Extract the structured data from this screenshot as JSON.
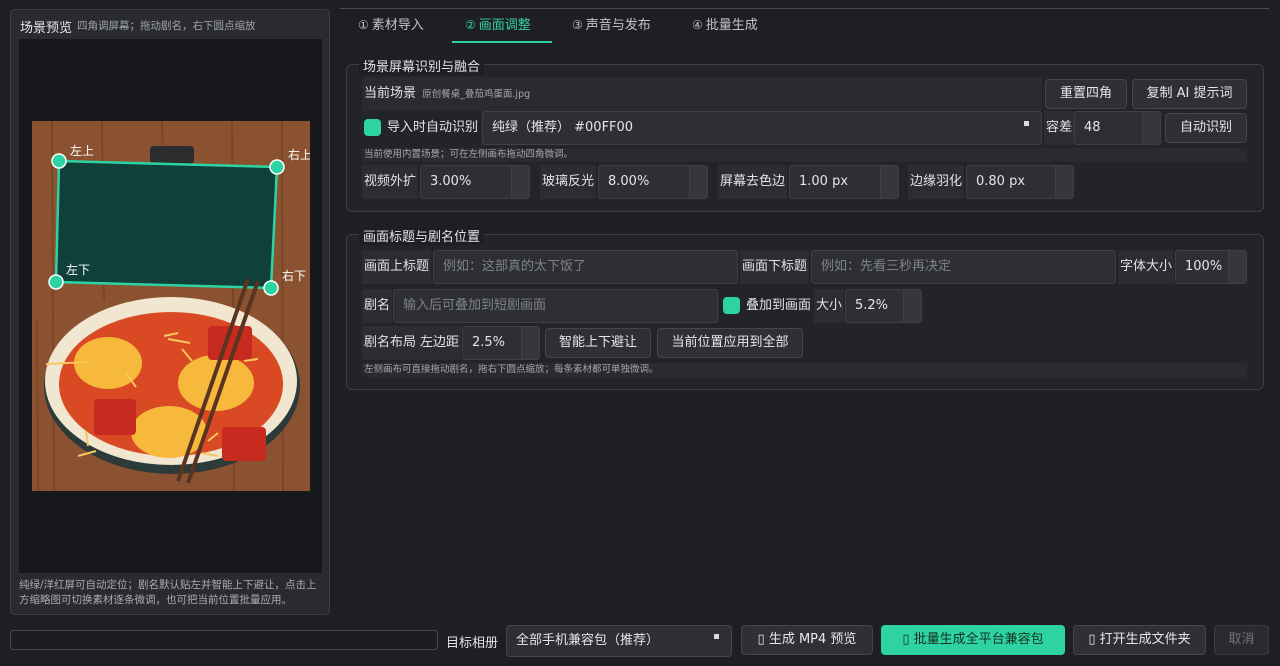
{
  "preview": {
    "title": "场景预览",
    "hint": "四角调屏幕；拖动剧名，右下圆点缩放",
    "corners": {
      "tl": "左上",
      "tr": "右上",
      "bl": "左下",
      "br": "右下"
    },
    "footer": "纯绿/洋红屏可自动定位；剧名默认贴左并智能上下避让，点击上方缩略图可切换素材逐条微调，也可把当前位置批量应用。"
  },
  "tabs": [
    {
      "num": "①",
      "label": "素材导入"
    },
    {
      "num": "②",
      "label": "画面调整"
    },
    {
      "num": "③",
      "label": "声音与发布"
    },
    {
      "num": "④",
      "label": "批量生成"
    }
  ],
  "screen_group": {
    "title": "场景屏幕识别与融合",
    "current_scene_label": "当前场景",
    "current_scene_value": "原创餐桌_叠茄鸡蛋面.jpg",
    "reset_corners": "重置四角",
    "copy_ai_prompt": "复制 AI 提示词",
    "auto_detect_on_import": "导入时自动识别",
    "color_mode": "纯绿（推荐）  #00FF00",
    "tolerance_label": "容差",
    "tolerance_value": "48",
    "auto_detect": "自动识别",
    "note": "当前使用内置场景；可在左侧画布拖动四角微调。",
    "video_expand_label": "视频外扩",
    "video_expand_value": "3.00%",
    "glass_reflect_label": "玻璃反光",
    "glass_reflect_value": "8.00%",
    "screen_trim_label": "屏幕去色边",
    "screen_trim_value": "1.00 px",
    "edge_feather_label": "边缘羽化",
    "edge_feather_value": "0.80 px"
  },
  "title_group": {
    "title": "画面标题与剧名位置",
    "top_title_label": "画面上标题",
    "top_title_placeholder": "例如：这部真的太下饭了",
    "bottom_title_label": "画面下标题",
    "bottom_title_placeholder": "例如：先看三秒再决定",
    "font_size_label": "字体大小",
    "font_size_value": "100%",
    "drama_label": "剧名",
    "drama_placeholder": "输入后可叠加到短剧画面",
    "overlay_label": "叠加到画面",
    "size_label": "大小",
    "size_value": "5.2%",
    "layout_label": "剧名布局",
    "left_margin_label": "左边距",
    "left_margin_value": "2.5%",
    "smart_avoid": "智能上下避让",
    "apply_all": "当前位置应用到全部",
    "note": "左侧画布可直接拖动剧名，拖右下圆点缩放；每条素材都可单独微调。"
  },
  "bottom": {
    "album_label": "目标相册",
    "album_value": "全部手机兼容包（推荐）",
    "preview_mp4": "▯ 生成 MP4 预览",
    "batch_generate": "▯ 批量生成全平台兼容包",
    "open_folder": "▯ 打开生成文件夹",
    "cancel": "取消"
  },
  "colors": {
    "accent": "#2ed3a3",
    "background": "#1e1f22",
    "panel": "#2a2b2f"
  }
}
